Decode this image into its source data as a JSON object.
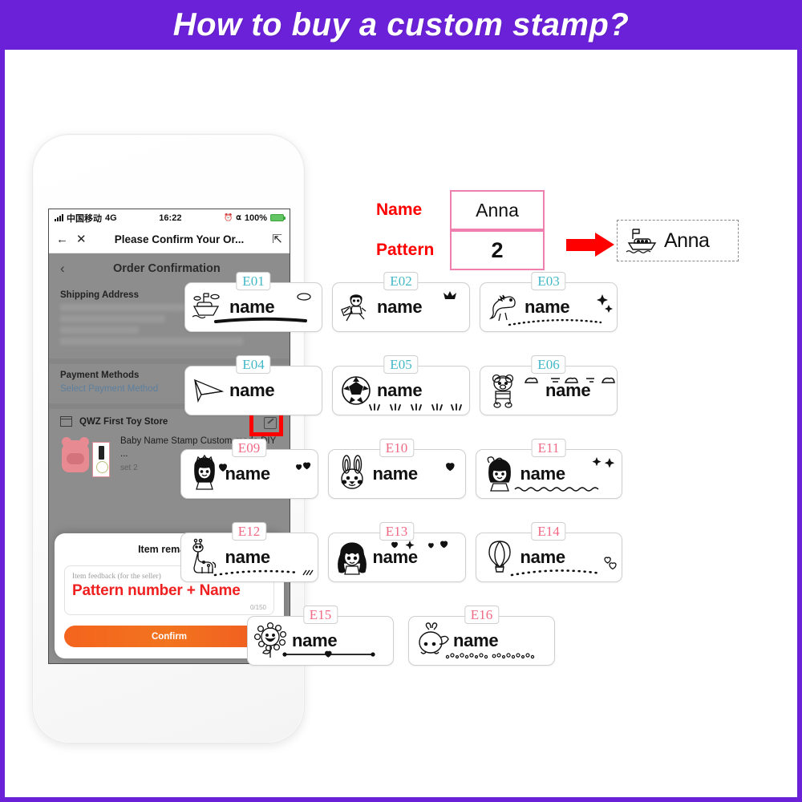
{
  "banner": {
    "title": "How to buy a custom stamp?",
    "bg_color": "#6B21D8",
    "text_color": "#FFFFFF"
  },
  "phone": {
    "status_bar": {
      "carrier": "中国移动",
      "network": "4G",
      "time": "16:22",
      "battery": "100%",
      "signal_icon": "signal-bars-icon",
      "alarm_icon": "alarm-icon",
      "headphone_icon": "headphone-icon",
      "battery_icon": "battery-charging-icon"
    },
    "nav_bar": {
      "back_icon": "back-arrow-icon",
      "close_icon": "close-icon",
      "title": "Please Confirm Your Or...",
      "share_icon": "share-icon"
    },
    "order": {
      "back_icon": "chevron-left-icon",
      "title": "Order Confirmation",
      "shipping_label": "Shipping Address",
      "shipping_chevron": "chevron-right-icon",
      "payment_label": "Payment Methods",
      "payment_action": "Select Payment Method",
      "store_icon": "store-icon",
      "store_name": "QWZ First Toy Store",
      "edit_icon": "edit-note-icon",
      "product_name": "Baby Name Stamp Custom-made DIY ...",
      "product_variant": "set 2",
      "highlight_color": "#FF0000"
    },
    "modal": {
      "title": "Item remarks",
      "close_icon": "close-icon",
      "input_placeholder": "Item feedback (for the seller)",
      "input_value": "Pattern number + Name",
      "input_value_color": "#F02020",
      "counter": "0/150",
      "confirm_label": "Confirm",
      "confirm_color": "#F2741F"
    }
  },
  "form": {
    "name_label": "Name",
    "name_value": "Anna",
    "pattern_label": "Pattern",
    "pattern_value": "2",
    "label_color": "#FF0000",
    "field_border_color": "#EF7FAE",
    "arrow_icon": "right-arrow-icon",
    "arrow_color": "#FF0000",
    "result_name": "Anna",
    "result_art": "boat-icon"
  },
  "sticker_label": "name",
  "sticker_rows": [
    [
      {
        "code": "E01",
        "code_color": "teal",
        "art": "boat-icon",
        "deco": "clouds-and-underline"
      },
      {
        "code": "E02",
        "code_color": "teal",
        "art": "boy-running-icon",
        "deco": "crown"
      },
      {
        "code": "E03",
        "code_color": "teal",
        "art": "dinosaur-icon",
        "deco": "sparkles-and-dotted-line"
      }
    ],
    [
      {
        "code": "E04",
        "code_color": "teal",
        "art": "paper-plane-icon",
        "deco": "none"
      },
      {
        "code": "E05",
        "code_color": "teal",
        "art": "soccer-ball-icon",
        "deco": "grass"
      },
      {
        "code": "E06",
        "code_color": "teal",
        "art": "bear-icon",
        "deco": "clouds"
      }
    ],
    [
      {
        "code": "E09",
        "code_color": "pink",
        "art": "princess-icon",
        "deco": "hearts"
      },
      {
        "code": "E10",
        "code_color": "pink",
        "art": "bunny-icon",
        "deco": "heart"
      },
      {
        "code": "E11",
        "code_color": "pink",
        "art": "girl-bow-icon",
        "deco": "stars-and-wave-line"
      }
    ],
    [
      {
        "code": "E12",
        "code_color": "pink",
        "art": "giraffe-icon",
        "deco": "dotted-line"
      },
      {
        "code": "E13",
        "code_color": "pink",
        "art": "girl-pigtails-icon",
        "deco": "hearts-and-star"
      },
      {
        "code": "E14",
        "code_color": "pink",
        "art": "hot-air-balloon-icon",
        "deco": "dotted-line-and-hearts"
      }
    ],
    [
      {
        "code": "E15",
        "code_color": "pink",
        "art": "sunflower-icon",
        "deco": "heart-line"
      },
      {
        "code": "E16",
        "code_color": "pink",
        "art": "whale-icon",
        "deco": "bubbles"
      }
    ]
  ]
}
